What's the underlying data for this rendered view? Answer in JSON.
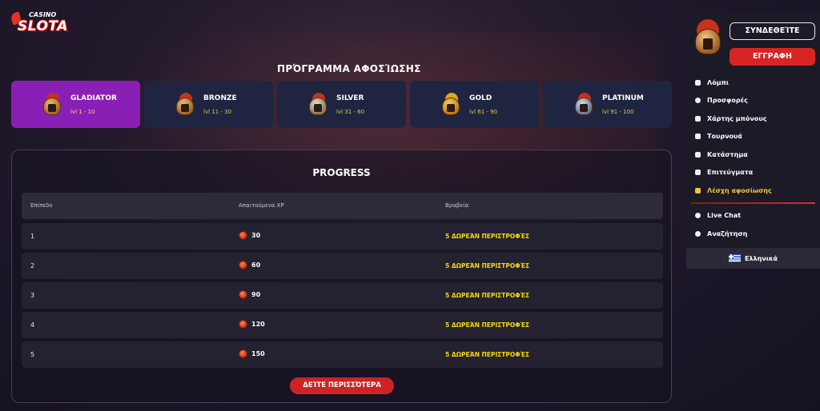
{
  "brand": {
    "top": "CASINO",
    "name": "SLOTA"
  },
  "page_title": "ΠΡΌΓΡΑΜΜΑ ΑΦΟΣΊΩΣΗΣ",
  "tiers": [
    {
      "name": "GLADIATOR",
      "range": "lvl 1 - 10",
      "icon": "gladiator-helmet-icon",
      "active": true
    },
    {
      "name": "BRONZE",
      "range": "lvl 11 - 30",
      "icon": "bronze-helmet-icon",
      "active": false
    },
    {
      "name": "SILVER",
      "range": "lvl 31 - 60",
      "icon": "silver-helmet-icon",
      "active": false
    },
    {
      "name": "GOLD",
      "range": "lvl 61 - 90",
      "icon": "gold-helmet-icon",
      "active": false
    },
    {
      "name": "PLATINUM",
      "range": "lvl 91 - 100",
      "icon": "platinum-helmet-icon",
      "active": false
    }
  ],
  "progress": {
    "title": "PROGRESS",
    "columns": [
      "Επίπεδο",
      "Απαιτούμενα XP",
      "Βραβεία"
    ],
    "rows": [
      {
        "level": "1",
        "xp": "30",
        "reward": "5 ΔΩΡΕΆΝ ΠΕΡΙΣΤΡΟΦΈΣ"
      },
      {
        "level": "2",
        "xp": "60",
        "reward": "5 ΔΩΡΕΆΝ ΠΕΡΙΣΤΡΟΦΈΣ"
      },
      {
        "level": "3",
        "xp": "90",
        "reward": "5 ΔΩΡΕΆΝ ΠΕΡΙΣΤΡΟΦΈΣ"
      },
      {
        "level": "4",
        "xp": "120",
        "reward": "5 ΔΩΡΕΆΝ ΠΕΡΙΣΤΡΟΦΈΣ"
      },
      {
        "level": "5",
        "xp": "150",
        "reward": "5 ΔΩΡΕΆΝ ΠΕΡΙΣΤΡΟΦΈΣ"
      }
    ],
    "see_more_label": "ΔΕΊΤΕ ΠΕΡΙΣΣΌΤΕΡΑ"
  },
  "sidebar": {
    "login_label": "ΣΥΝΔΕΘΕΊΤΕ",
    "register_label": "ΕΓΓΡΑΦΗ",
    "menu": [
      {
        "label": "Λόμπι",
        "icon": "lobby-icon"
      },
      {
        "label": "Προσφορές",
        "icon": "promotions-icon"
      },
      {
        "label": "Χάρτης μπόνους",
        "icon": "bonus-map-icon"
      },
      {
        "label": "Τουρνουά",
        "icon": "tournament-icon"
      },
      {
        "label": "Κατάστημα",
        "icon": "shop-icon"
      },
      {
        "label": "Επιτεύγματα",
        "icon": "achievements-icon"
      },
      {
        "label": "Λέσχη αφοσίωσης",
        "icon": "loyalty-club-icon",
        "active": true
      }
    ],
    "extra": [
      {
        "label": "Live Chat",
        "icon": "chat-icon"
      },
      {
        "label": "Αναζήτηση",
        "icon": "search-icon"
      }
    ],
    "language": "Ελληνικά"
  },
  "colors": {
    "accent_purple": "#8a1fb5",
    "accent_red": "#d92424",
    "reward_yellow": "#f5d90a"
  }
}
